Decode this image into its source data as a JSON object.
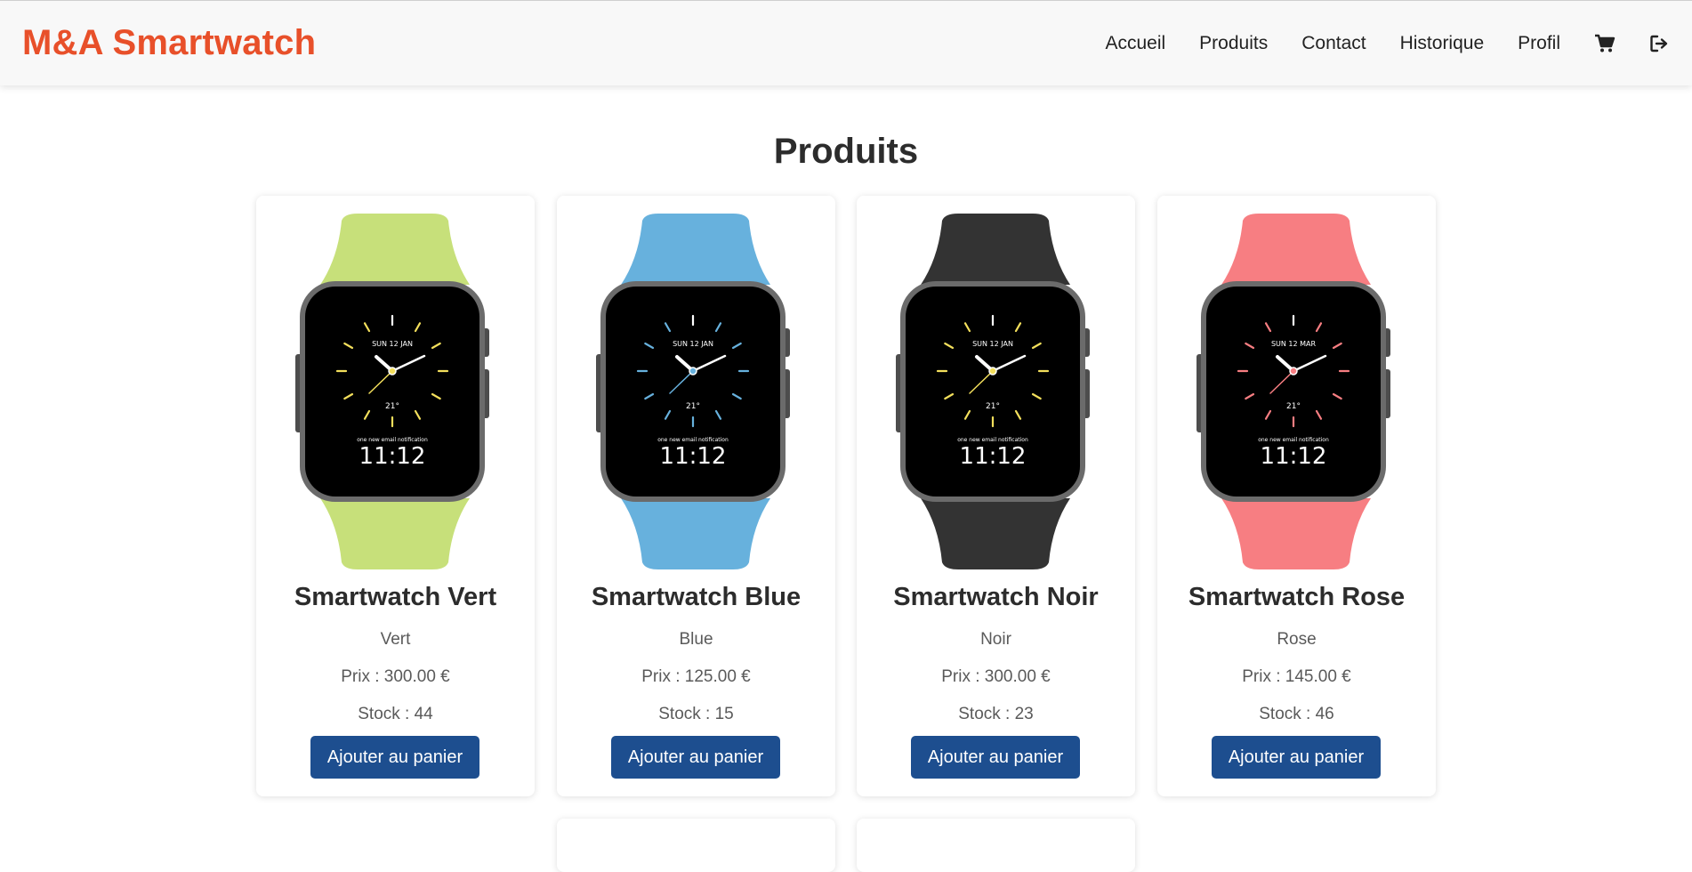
{
  "brand": "M&A Smartwatch",
  "nav": {
    "links": [
      "Accueil",
      "Produits",
      "Contact",
      "Historique",
      "Profil"
    ],
    "icons": [
      "cart-icon",
      "logout-icon"
    ]
  },
  "page_title": "Produits",
  "products": [
    {
      "name": "Smartwatch Vert",
      "color": "Vert",
      "price": "Prix : 300.00 €",
      "stock": "Stock : 44",
      "button": "Ajouter au panier",
      "band_color": "#c7e07a",
      "accent_color": "#f3df5c",
      "face_date": "SUN 12 JAN",
      "face_temp": "21°",
      "face_notice": "one new email notification",
      "face_time": "11:12"
    },
    {
      "name": "Smartwatch Blue",
      "color": "Blue",
      "price": "Prix : 125.00 €",
      "stock": "Stock : 15",
      "button": "Ajouter au panier",
      "band_color": "#67b1dd",
      "accent_color": "#67b1dd",
      "face_date": "SUN 12 JAN",
      "face_temp": "21°",
      "face_notice": "one new email notification",
      "face_time": "11:12"
    },
    {
      "name": "Smartwatch Noir",
      "color": "Noir",
      "price": "Prix : 300.00 €",
      "stock": "Stock : 23",
      "button": "Ajouter au panier",
      "band_color": "#333333",
      "accent_color": "#f3df5c",
      "face_date": "SUN 12 JAN",
      "face_temp": "21°",
      "face_notice": "one new email notification",
      "face_time": "11:12"
    },
    {
      "name": "Smartwatch Rose",
      "color": "Rose",
      "price": "Prix : 145.00 €",
      "stock": "Stock : 46",
      "button": "Ajouter au panier",
      "band_color": "#f77e82",
      "accent_color": "#f77e82",
      "face_date": "SUN 12 MAR",
      "face_temp": "21°",
      "face_notice": "one new email notification",
      "face_time": "11:12"
    }
  ]
}
